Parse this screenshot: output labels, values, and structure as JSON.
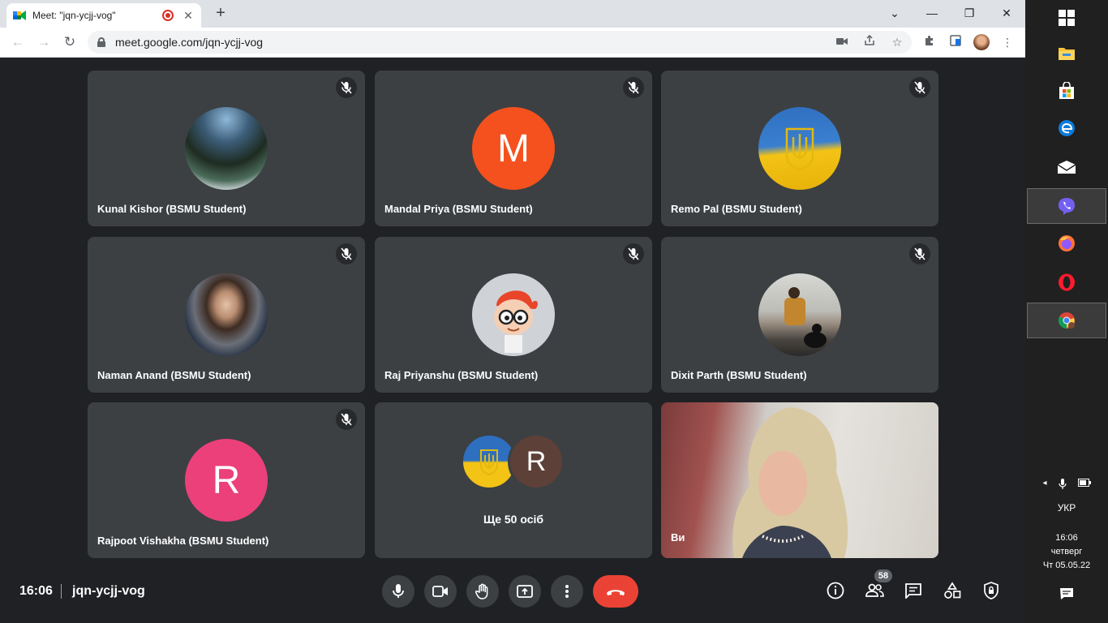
{
  "tab": {
    "title": "Meet: \"jqn-ycjj-vog\""
  },
  "address": {
    "url": "meet.google.com/jqn-ycjj-vog"
  },
  "participants": [
    {
      "name": "Kunal Kishor (BSMU Student)",
      "avatar_type": "photo-landscape"
    },
    {
      "name": "Mandal Priya (BSMU Student)",
      "avatar_letter": "M",
      "avatar_color": "#f4511e"
    },
    {
      "name": "Remo Pal (BSMU Student)",
      "avatar_type": "ukraine-flag"
    },
    {
      "name": "Naman Anand (BSMU Student)",
      "avatar_type": "photo-person"
    },
    {
      "name": "Raj Priyanshu (BSMU Student)",
      "avatar_type": "cartoon"
    },
    {
      "name": "Dixit Parth (BSMU Student)",
      "avatar_type": "photo-person-dog"
    },
    {
      "name": "Rajpoot Vishakha (BSMU Student)",
      "avatar_letter": "R",
      "avatar_color": "#ec407a"
    }
  ],
  "more_tile": {
    "avatar_letter": "R",
    "avatar_color": "#5d4037",
    "label": "Ще 50 осіб"
  },
  "self_tile": {
    "label": "Ви"
  },
  "meeting": {
    "time": "16:06",
    "code": "jqn-ycjj-vog",
    "participant_count": "58"
  },
  "colors": {
    "end_call": "#ea4335",
    "tile": "#3c4043",
    "background": "#202124"
  },
  "system_tray": {
    "language": "УКР",
    "time": "16:06",
    "day": "четверг",
    "date": "Чт 05.05.22"
  }
}
